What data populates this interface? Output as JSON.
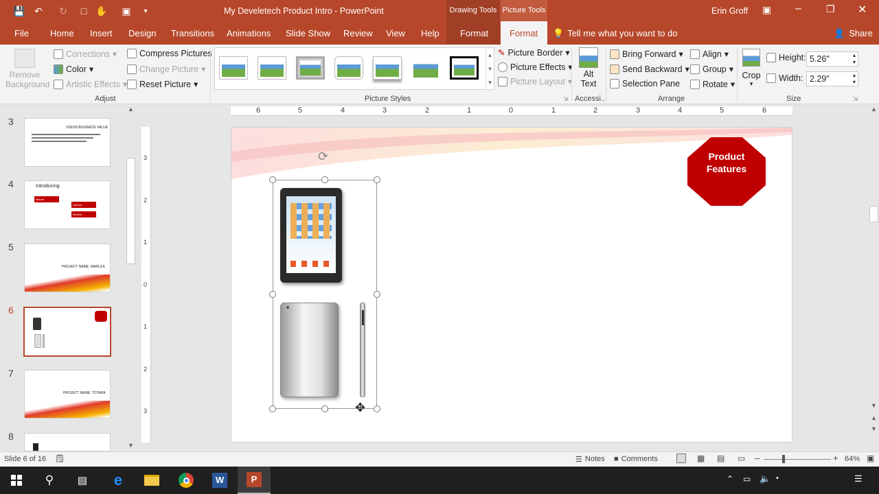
{
  "titlebar": {
    "doc_title": "My Develetech Product Intro  -  PowerPoint",
    "context_drawing": "Drawing Tools",
    "context_picture": "Picture Tools",
    "user": "Erin Groff"
  },
  "tabs": [
    "File",
    "Home",
    "Insert",
    "Design",
    "Transitions",
    "Animations",
    "Slide Show",
    "Review",
    "View",
    "Help",
    "Format",
    "Format"
  ],
  "tell_me": "Tell me what you want to do",
  "share": "Share",
  "ribbon": {
    "remove_background": [
      "Remove",
      "Background"
    ],
    "corrections": "Corrections",
    "color": "Color",
    "artistic_effects": "Artistic Effects",
    "compress_pictures": "Compress Pictures",
    "change_picture": "Change Picture",
    "reset_picture": "Reset Picture",
    "adjust_group": "Adjust",
    "picture_styles_group": "Picture Styles",
    "picture_border": "Picture Border",
    "picture_effects": "Picture Effects",
    "picture_layout": "Picture Layout",
    "alt_text": [
      "Alt",
      "Text"
    ],
    "accessibility_group": "Accessi...",
    "bring_forward": "Bring Forward",
    "send_backward": "Send Backward",
    "selection_pane": "Selection Pane",
    "align": "Align",
    "group": "Group",
    "rotate": "Rotate",
    "arrange_group": "Arrange",
    "crop": "Crop",
    "height_label": "Height:",
    "height_value": "5.26\"",
    "width_label": "Width:",
    "width_value": "2.29\"",
    "size_group": "Size"
  },
  "ruler_labels": [
    "6",
    "5",
    "4",
    "3",
    "2",
    "1",
    "0",
    "1",
    "2",
    "3",
    "4",
    "5",
    "6"
  ],
  "vruler_labels": [
    "3",
    "2",
    "1",
    "0",
    "1",
    "2",
    "3"
  ],
  "thumbnails": [
    {
      "num": "3",
      "title": "VISION BUSINESS VALUE"
    },
    {
      "num": "4",
      "title": "Introducing",
      "tags": [
        "Marula",
        "Sylvara",
        "Medina"
      ]
    },
    {
      "num": "5",
      "title": "PROJECT NAME: MARULA"
    },
    {
      "num": "6",
      "title": ""
    },
    {
      "num": "7",
      "title": "PROJECT NAME: TOTARA"
    },
    {
      "num": "8",
      "title": ""
    }
  ],
  "slide": {
    "badge_line1": "Product",
    "badge_line2": "Features"
  },
  "status": {
    "slide_info": "Slide 6 of 16",
    "notes": "Notes",
    "comments": "Comments",
    "zoom": "64%"
  },
  "colors": {
    "accent": "#b7472a",
    "badge": "#c00000"
  }
}
